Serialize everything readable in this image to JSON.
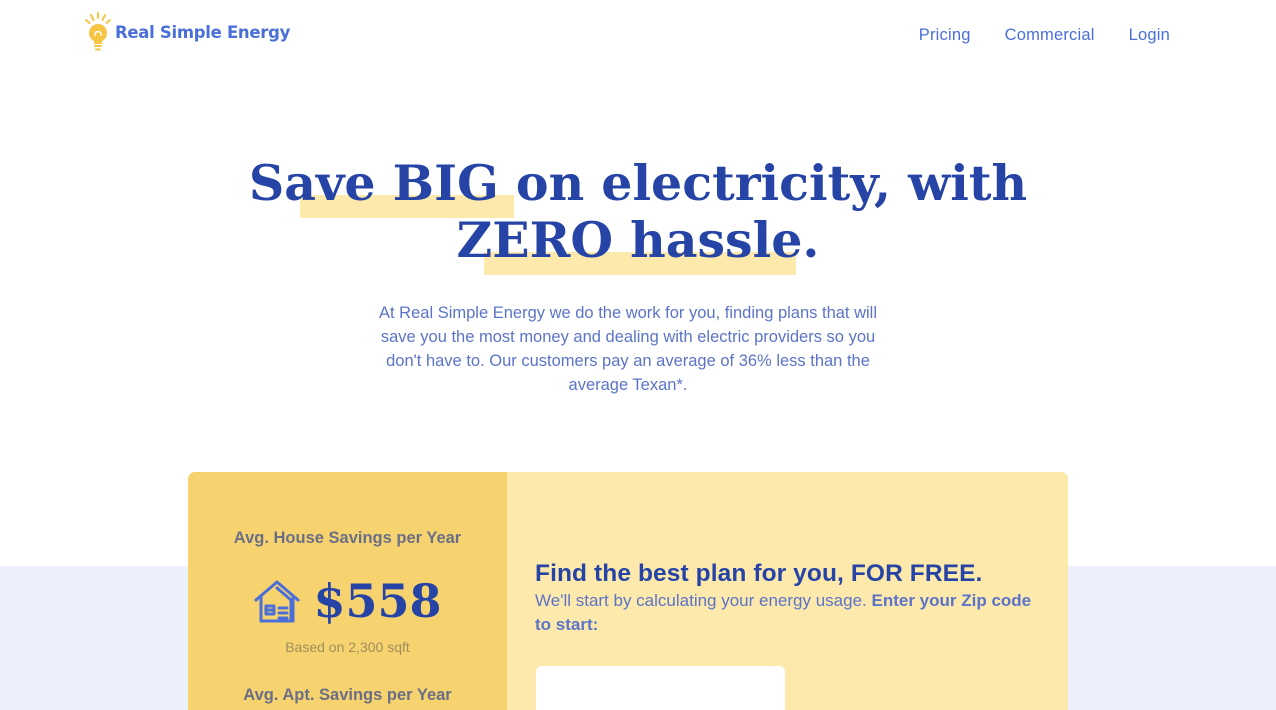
{
  "header": {
    "brand": "Real Simple Energy",
    "nav": [
      "Pricing",
      "Commercial",
      "Login"
    ]
  },
  "hero": {
    "title_line1": "Save BIG on electricity, with",
    "title_line2": "ZERO hassle.",
    "subtitle": "At Real Simple Energy we do the work for you, finding plans that will save you the most money and dealing with electric providers so you don't have to. Our customers pay an average of 36% less than the average Texan*."
  },
  "savings": {
    "house_label": "Avg. House Savings per Year",
    "house_value": "$558",
    "house_note": "Based on 2,300 sqft",
    "apt_label": "Avg. Apt. Savings per Year"
  },
  "signup": {
    "title": "Find the best plan for you, FOR FREE.",
    "subtitle": "We'll start by calculating your energy usage.",
    "subtitle_strong": "Enter your Zip code to start:",
    "zip_value": "",
    "zip_placeholder": ""
  },
  "colors": {
    "brand_blue": "#2644a6",
    "link_blue": "#4a6fd8",
    "highlight_yellow": "#fde9ab",
    "card_yellow": "#f6d36e",
    "band_blue": "#ebf0fb"
  },
  "icons": {
    "logo": "lightbulb-icon",
    "house": "house-icon"
  }
}
